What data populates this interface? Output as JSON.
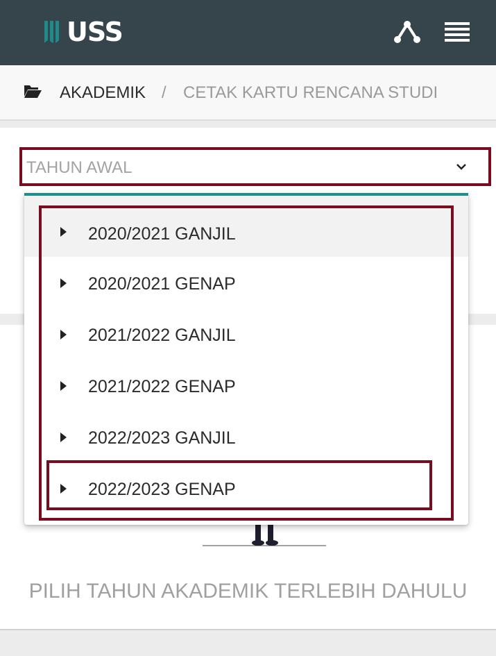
{
  "header": {
    "logo_text": "USS",
    "colors": {
      "bar": "#36454c",
      "logo_mark": "#1f8a8a"
    },
    "icons": [
      "network-icon",
      "menu-icon"
    ]
  },
  "breadcrumb": {
    "icon": "folder-open-icon",
    "items": [
      "AKADEMIK",
      "CETAK KARTU RENCANA STUDI"
    ],
    "separator": "/"
  },
  "filter": {
    "select_placeholder": "TAHUN AWAL",
    "icon": "chevron-down-icon",
    "options": [
      "2020/2021 GANJIL",
      "2020/2021 GENAP",
      "2021/2022 GANJIL",
      "2021/2022 GENAP",
      "2022/2023 GANJIL",
      "2022/2023 GENAP"
    ],
    "highlighted_option": "2020/2021 GANJIL",
    "colors": {
      "dropdown_accent": "#1e8f87",
      "annotation_border": "#7a0c1f"
    }
  },
  "content": {
    "empty_message": "PILIH TAHUN AKADEMIK TERLEBIH DAHULU"
  }
}
